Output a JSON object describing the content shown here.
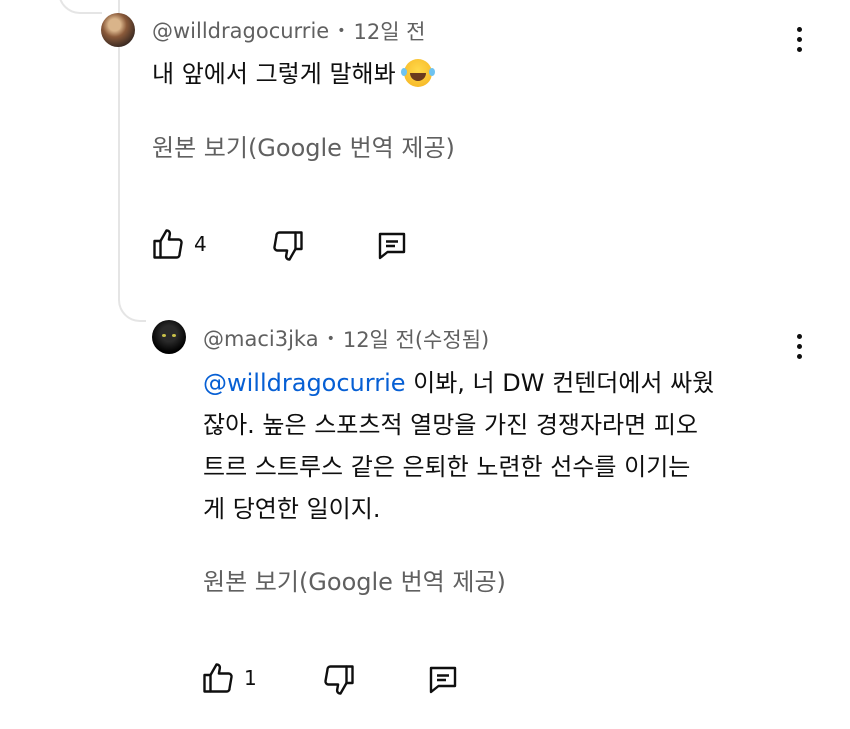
{
  "comments": [
    {
      "handle": "@willdragocurrie",
      "sep": "•",
      "time": "12일 전",
      "text": "내 앞에서 그렇게 말해봐",
      "emoji_name": "face-with-tears-of-joy",
      "see_original": "원본 보기(Google 번역 제공)",
      "likes": "4"
    },
    {
      "handle": "@maci3jka",
      "sep": "•",
      "time": "12일 전(수정됨)",
      "mention": "@willdragocurrie",
      "text_lines": [
        " 이봐, 너 DW 컨텐더에서 싸웠",
        "잖아. 높은 스포츠적 열망을 가진 경쟁자라면 피오",
        "트르 스트루스 같은 은퇴한 노련한 선수를 이기는",
        "게 당연한 일이지."
      ],
      "see_original": "원본 보기(Google 번역 제공)",
      "likes": "1"
    }
  ],
  "colors": {
    "text": "#0f0f0f",
    "secondary": "#606060",
    "mention": "#065fd4",
    "thread_line": "#e5e5e5"
  },
  "icons": [
    "like-icon",
    "dislike-icon",
    "reply-icon",
    "more-vert-icon"
  ]
}
